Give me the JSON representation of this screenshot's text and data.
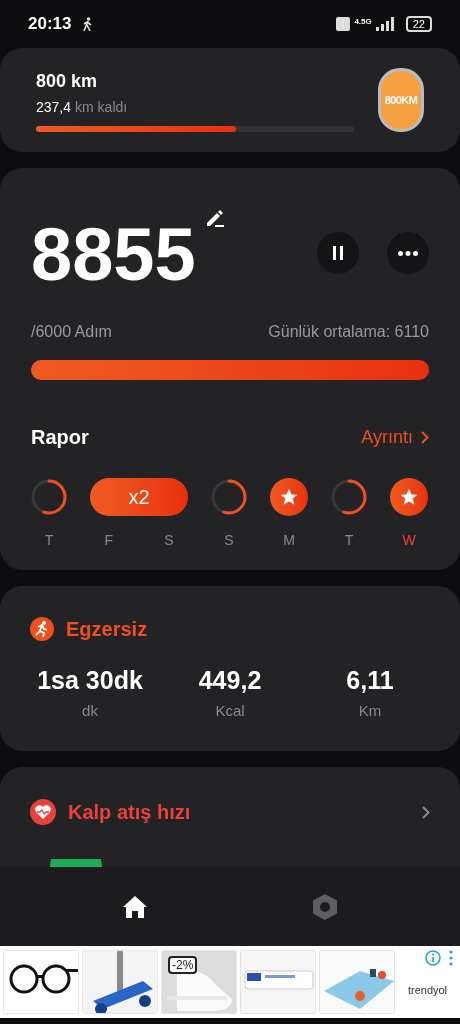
{
  "status_bar": {
    "time": "20:13",
    "network": "4.5G",
    "battery": "22"
  },
  "distance_goal": {
    "title": "800 km",
    "remaining_value": "237,4",
    "remaining_unit": "km kaldı",
    "level": 0.63,
    "badge": "800KM"
  },
  "steps": {
    "count": "8855",
    "goal": "/6000 Adım",
    "average": "Günlük ortalama: 6110",
    "level": 1.0
  },
  "report": {
    "title": "Rapor",
    "link": "Ayrıntı",
    "days": [
      {
        "kind": "ring",
        "label": "T",
        "selected": false
      },
      {
        "kind": "streak",
        "text": "x2",
        "labels": [
          "F",
          "S"
        ],
        "selected": false
      },
      {
        "kind": "ring",
        "label": "S",
        "selected": false
      },
      {
        "kind": "star",
        "label": "M",
        "selected": false
      },
      {
        "kind": "ring",
        "label": "T",
        "selected": false
      },
      {
        "kind": "star",
        "label": "W",
        "selected": true
      }
    ]
  },
  "exercise": {
    "title": "Egzersiz",
    "stats": [
      {
        "value": "1sa 30dk",
        "unit": "dk"
      },
      {
        "value": "449,2",
        "unit": "Kcal"
      },
      {
        "value": "6,11",
        "unit": "Km"
      }
    ]
  },
  "heart_rate": {
    "title": "Kalp atış hızı"
  },
  "nav": [
    {
      "kind": "home",
      "selected": true
    },
    {
      "kind": "settings",
      "selected": false
    }
  ],
  "ad": {
    "discount": "-2%",
    "brand": "trendyol"
  }
}
